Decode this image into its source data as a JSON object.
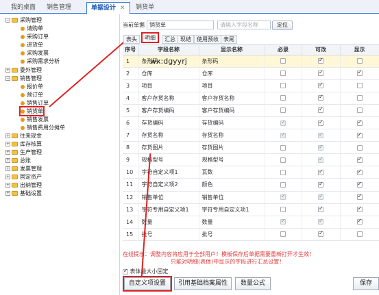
{
  "top_tabs": [
    {
      "label": "我的桌面"
    },
    {
      "label": "销售管理"
    },
    {
      "label": "单据设计",
      "active": true,
      "close": "✕"
    },
    {
      "label": "销货单"
    }
  ],
  "tree": [
    {
      "label": "采购管理",
      "type": "folder",
      "exp": "−"
    },
    {
      "label": "请购单",
      "type": "leaf"
    },
    {
      "label": "采购订单",
      "type": "leaf"
    },
    {
      "label": "进货单",
      "type": "leaf"
    },
    {
      "label": "采购发票",
      "type": "leaf"
    },
    {
      "label": "采购需求分析",
      "type": "leaf"
    },
    {
      "label": "委外管理",
      "type": "folder",
      "exp": "+"
    },
    {
      "label": "销售管理",
      "type": "folder",
      "exp": "−"
    },
    {
      "label": "报价单",
      "type": "leaf"
    },
    {
      "label": "预订单",
      "type": "leaf"
    },
    {
      "label": "销售订单",
      "type": "leaf"
    },
    {
      "label": "销货单",
      "type": "leaf",
      "highlight": true
    },
    {
      "label": "销售发票",
      "type": "leaf"
    },
    {
      "label": "销售费用分摊单",
      "type": "leaf"
    },
    {
      "label": "往来现金",
      "type": "folder",
      "exp": "+"
    },
    {
      "label": "库存核算",
      "type": "folder",
      "exp": "+"
    },
    {
      "label": "生产管理",
      "type": "folder",
      "exp": "+"
    },
    {
      "label": "总账",
      "type": "folder",
      "exp": "+"
    },
    {
      "label": "发票管理",
      "type": "folder",
      "exp": "+"
    },
    {
      "label": "固定资产",
      "type": "folder",
      "exp": "+"
    },
    {
      "label": "出纳管理",
      "type": "folder",
      "exp": "+"
    },
    {
      "label": "基础设置",
      "type": "folder",
      "exp": "+"
    }
  ],
  "header": {
    "current_doc_label": "当前单据",
    "current_doc_value": "销货单",
    "search_placeholder": "请输入字段名称",
    "locate_button": "定位"
  },
  "sub_tabs": [
    {
      "label": "表头"
    },
    {
      "label": "明细",
      "active": true
    },
    {
      "label": "汇总"
    },
    {
      "label": "现结"
    },
    {
      "label": "使用预收"
    },
    {
      "label": "表尾"
    }
  ],
  "grid": {
    "columns": [
      "序号",
      "字段名称",
      "显示名称",
      "必录",
      "可改",
      "显示"
    ],
    "rows": [
      {
        "no": "1",
        "field": "条形码",
        "display": "条形码",
        "req": [
          false,
          false
        ],
        "edit": [
          true,
          false
        ],
        "show": [
          false,
          false
        ],
        "selected": true
      },
      {
        "no": "2",
        "field": "仓库",
        "display": "仓库",
        "req": [
          false,
          false
        ],
        "edit": [
          true,
          false
        ],
        "show": [
          true,
          false
        ]
      },
      {
        "no": "3",
        "field": "项目",
        "display": "项目",
        "req": [
          false,
          false
        ],
        "edit": [
          true,
          false
        ],
        "show": [
          false,
          false
        ]
      },
      {
        "no": "4",
        "field": "客户存货名称",
        "display": "客户存货名称",
        "req": [
          false,
          false
        ],
        "edit": [
          true,
          false
        ],
        "show": [
          false,
          false
        ]
      },
      {
        "no": "5",
        "field": "客户存货编码",
        "display": "客户存货编码",
        "req": [
          false,
          false
        ],
        "edit": [
          true,
          false
        ],
        "show": [
          false,
          false
        ]
      },
      {
        "no": "6",
        "field": "存货编码",
        "display": "存货编码",
        "req": [
          true,
          true
        ],
        "edit": [
          true,
          false
        ],
        "show": [
          true,
          false
        ]
      },
      {
        "no": "7",
        "field": "存货名称",
        "display": "存货名称",
        "req": [
          true,
          true
        ],
        "edit": [
          true,
          true
        ],
        "show": [
          true,
          false
        ]
      },
      {
        "no": "8",
        "field": "存货图片",
        "display": "存货图片",
        "req": [
          false,
          false
        ],
        "edit": [
          true,
          true
        ],
        "show": [
          false,
          false
        ]
      },
      {
        "no": "9",
        "field": "规格型号",
        "display": "规格型号",
        "req": [
          false,
          false
        ],
        "edit": [
          true,
          true
        ],
        "show": [
          true,
          false
        ]
      },
      {
        "no": "10",
        "field": "字符自定义项1",
        "display": "瓦数",
        "req": [
          false,
          false
        ],
        "edit": [
          true,
          false
        ],
        "show": [
          true,
          false
        ]
      },
      {
        "no": "11",
        "field": "字符自定义项2",
        "display": "颜色",
        "req": [
          false,
          false
        ],
        "edit": [
          true,
          false
        ],
        "show": [
          true,
          false
        ]
      },
      {
        "no": "12",
        "field": "销售单位",
        "display": "销售单位",
        "req": [
          true,
          true
        ],
        "edit": [
          true,
          true
        ],
        "show": [
          true,
          false
        ]
      },
      {
        "no": "13",
        "field": "字符专用自定义项1",
        "display": "字符专用自定义项1",
        "req": [
          false,
          false
        ],
        "edit": [
          true,
          false
        ],
        "show": [
          true,
          false
        ]
      },
      {
        "no": "14",
        "field": "数量",
        "display": "数量",
        "req": [
          true,
          true
        ],
        "edit": [
          true,
          true
        ],
        "show": [
          true,
          false
        ]
      },
      {
        "no": "15",
        "field": "批号",
        "display": "批号",
        "req": [
          false,
          false
        ],
        "edit": [
          true,
          false
        ],
        "show": [
          false,
          false
        ]
      }
    ]
  },
  "watermark": "wx:dgyyrj",
  "hint": {
    "line1": "在线提示：调整内容将应用于全部用户！模板保存后单据需要重新打开才生效！",
    "line2": "只能对明细(表体)中显示的字段进行汇总设置！"
  },
  "fixed_checkbox_label": "表体最大小固定",
  "buttons": {
    "custom": "自定义项设置",
    "reference": "引用基础档案属性",
    "formula": "数量公式",
    "save": "保存"
  },
  "colors": {
    "accent": "#3a7bd5",
    "highlight": "#e02020",
    "hint": "#e23a3a"
  }
}
